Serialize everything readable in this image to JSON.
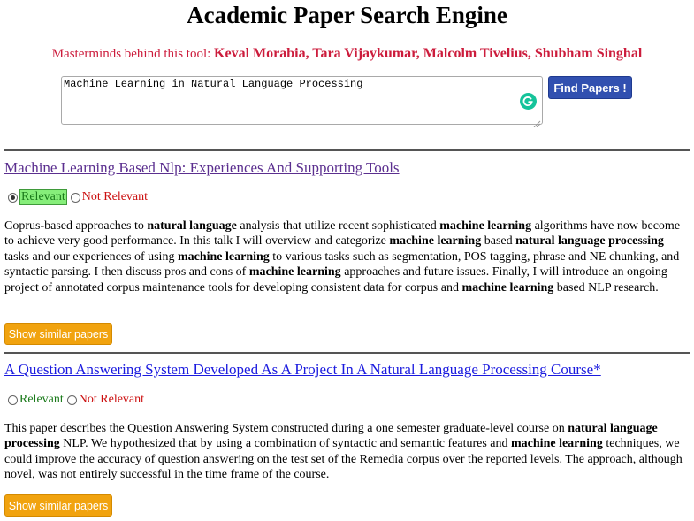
{
  "header": {
    "title": "Academic Paper Search Engine",
    "credits_prefix": "Masterminds behind this tool: ",
    "credits_names": "Keval Morabia, Tara Vijaykumar, Malcolm Tivelius, Shubham Singhal"
  },
  "search": {
    "query": "Machine Learning in Natural Language Processing",
    "button_label": "Find Papers !"
  },
  "results": [
    {
      "title": "Machine Learning Based Nlp: Experiences And Supporting Tools",
      "relevant_label": "Relevant",
      "not_relevant_label": "Not Relevant",
      "selected": "relevant",
      "abstract_html": "Coprus-based approaches to <b>natural language</b> analysis that utilize recent sophisticated <b>machine learning</b> algorithms have now become to achieve very good performance. In this talk I will overview and categorize <b>machine learning</b> based <b>natural language processing</b> tasks and our experiences of using <b>machine learning</b> to various tasks such as segmentation, POS tagging, phrase and NE chunking, and syntactic parsing. I then discuss pros and cons of <b>machine learning</b> approaches and future issues. Finally, I will introduce an ongoing project of annotated corpus maintenance tools for developing consistent data for corpus and <b>machine learning</b> based NLP research.",
      "similar_button": "Show similar papers"
    },
    {
      "title": "A Question Answering System Developed As A Project In A Natural Language Processing Course*",
      "relevant_label": "Relevant",
      "not_relevant_label": "Not Relevant",
      "selected": "none",
      "abstract_html": "This paper describes the Question Answering System constructed during a one semester graduate-level course on <b>natural language processing</b> NLP. We hypothesized that by using a combination of syntactic and semantic features and <b>machine learning</b> techniques, we could improve the accuracy of question answering on the test set of the Remedia corpus over the reported levels. The approach, although novel, was not entirely successful in the time frame of the course.",
      "similar_button": "Show similar papers"
    }
  ],
  "colors": {
    "credits": "#cc1c3c",
    "find_button": "#3150b0",
    "similar_button": "#f1a30f",
    "relevant": "#1a7a1a",
    "relevant_highlight": "#86ee7a",
    "not_relevant": "#cc1010",
    "visited_link": "#5b2f8f",
    "link": "#1a1adf"
  },
  "icons": {
    "grammarly": "grammarly-icon",
    "resize": "resize-handle-icon"
  }
}
